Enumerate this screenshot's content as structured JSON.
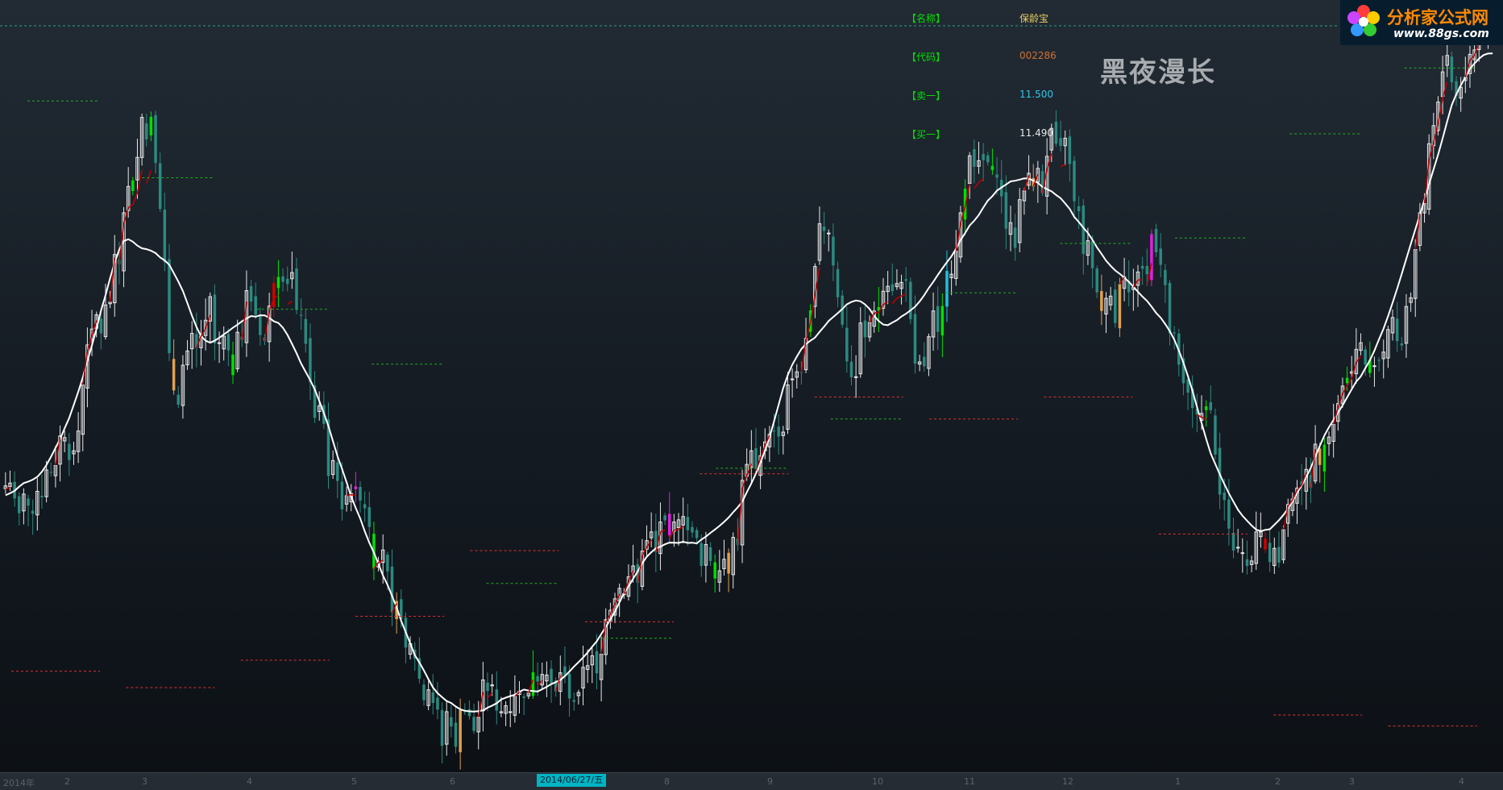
{
  "info_panel": {
    "name_label": "【名称】",
    "name_value": "保龄宝",
    "code_label": "【代码】",
    "code_value": "002286",
    "sell1_label": "【卖一】",
    "sell1_value": "11.500",
    "buy1_label": "【买一】",
    "buy1_value": "11.490"
  },
  "logo": {
    "title": "分析家公式网",
    "url": "www.88gs.com"
  },
  "watermark": "黑夜漫长",
  "time_axis": {
    "labels": [
      "2014年",
      "2",
      "3",
      "4",
      "5",
      "6",
      "8",
      "9",
      "10",
      "11",
      "12",
      "1",
      "2",
      "3",
      "4"
    ],
    "cursor_date": "2014/06/27/五"
  },
  "colors": {
    "up": "#e8e8e8",
    "down": "#2c8a80",
    "signal_green": "#00e000",
    "signal_red": "#d00000",
    "signal_magenta": "#e020e0",
    "signal_orange": "#e0a050",
    "signal_cyan": "#20c0e0",
    "ma_line": "#ffffff",
    "support": "#e03030",
    "resistance": "#20b020"
  },
  "chart_data": {
    "type": "candlestick",
    "title": "",
    "xlabel": "",
    "ylabel": "",
    "series": [
      {
        "name": "close",
        "values": [
          9.78,
          9.83,
          9.55,
          9.28,
          9.63,
          9.42,
          9.27,
          9.68,
          9.57,
          10.07,
          10.03,
          10.15,
          10.69,
          10.66,
          10.25,
          10.42,
          10.78,
          11.62,
          12.35,
          12.64,
          12.9,
          12.56,
          13.08,
          13.13,
          14.0,
          13.82,
          14.76,
          15.24,
          15.35,
          15.77,
          16.5,
          16.1,
          16.51,
          15.67,
          14.83,
          13.86,
          12.2,
          11.52,
          11.26,
          11.98,
          12.24,
          12.56,
          12.3,
          12.51,
          12.8,
          13.23,
          12.38,
          12.39,
          12.51,
          12.25,
          11.8,
          12.58,
          12.44,
          13.34,
          13.14,
          12.9,
          12.53,
          12.42,
          13.06,
          13.48,
          13.59,
          13.5,
          13.46,
          13.67,
          12.99,
          12.88,
          12.37,
          11.67,
          11.02,
          11.24,
          10.91,
          9.96,
          10.24,
          9.87,
          9.35,
          9.6,
          9.64,
          9.77,
          9.51,
          9.37,
          9.03,
          8.27,
          8.4,
          8.61,
          8.22,
          7.47,
          7.68,
          7.35,
          6.83,
          6.9,
          6.63,
          6.26,
          5.87,
          6.06,
          5.82,
          5.7,
          5.04,
          5.66,
          5.39,
          5.02,
          5.69,
          5.65,
          5.58,
          5.31,
          5.56,
          6.24,
          6.04,
          6.15,
          5.68,
          5.66,
          5.77,
          5.66,
          5.94,
          6.03,
          5.91,
          6.0,
          6.38,
          6.21,
          6.34,
          6.33,
          6.18,
          6.03,
          6.37,
          6.31,
          5.9,
          5.84,
          6.01,
          6.47,
          6.5,
          6.68,
          6.36,
          6.71,
          7.34,
          7.51,
          7.72,
          7.91,
          7.81,
          8.12,
          8.32,
          8.01,
          8.59,
          8.78,
          8.94,
          8.57,
          9.12,
          9.15,
          8.88,
          9.12,
          9.16,
          9.22,
          8.97,
          8.93,
          8.83,
          8.32,
          8.71,
          8.41,
          8.09,
          8.23,
          8.44,
          8.18,
          8.84,
          8.7,
          9.88,
          10.17,
          10.42,
          10.09,
          10.33,
          10.58,
          10.72,
          10.77,
          10.68,
          10.76,
          11.62,
          11.73,
          11.86,
          11.84,
          12.47,
          12.98,
          13.78,
          14.56,
          14.43,
          14.39,
          13.8,
          13.22,
          12.72,
          12.05,
          11.76,
          11.77,
          12.75,
          12.49,
          12.76,
          12.97,
          13.04,
          13.33,
          13.42,
          13.33,
          13.47,
          13.49,
          13.52,
          12.82,
          12.01,
          12.04,
          11.96,
          12.5,
          12.97,
          12.59,
          13.06,
          13.7,
          13.64,
          14.06,
          14.76,
          15.2,
          15.8,
          15.6,
          15.71,
          15.72,
          15.68,
          15.54,
          15.4,
          15.06,
          14.47,
          14.58,
          14.12,
          15.0,
          15.16,
          15.48,
          15.24,
          15.57,
          15.12,
          15.79,
          16.3,
          16.02,
          15.98,
          16.12,
          15.65,
          14.97,
          14.79,
          14.01,
          14.25,
          13.75,
          13.31,
          12.97,
          13.2,
          13.24,
          12.75,
          13.46,
          13.59,
          13.31,
          13.4,
          13.68,
          13.74,
          13.64,
          14.37,
          14.04,
          13.81,
          13.44,
          12.56,
          12.56,
          11.99,
          11.65,
          11.48,
          11.2,
          11.08,
          11.1,
          11.23,
          11.16,
          10.35,
          9.62,
          9.52,
          9.0,
          8.6,
          8.66,
          8.56,
          8.32,
          8.41,
          8.94,
          8.94,
          8.62,
          8.39,
          8.64,
          8.38,
          8.98,
          9.44,
          9.54,
          9.74,
          9.8,
          10.08,
          9.75,
          10.54,
          10.16,
          10.53,
          10.67,
          10.9,
          11.28,
          11.6,
          11.75,
          11.86,
          12.27,
          12.39,
          11.99,
          11.84,
          11.97,
          12.06,
          12.22,
          12.63,
          12.85,
          12.42,
          12.34,
          13.05,
          13.21,
          14.09,
          14.76,
          14.93,
          16.02,
          16.35,
          16.78,
          17.33,
          17.63,
          17.14,
          16.89,
          17.05,
          17.23,
          17.65,
          17.73,
          18.04,
          18.03,
          18.15,
          18.77
        ]
      }
    ],
    "support_levels": [
      6.4,
      6.1,
      6.6,
      7.4,
      8.6,
      7.3,
      10.0,
      11.4,
      11.0,
      11.4,
      8.9,
      5.6,
      5.4
    ],
    "resistance_levels": [
      16.8,
      15.4,
      13.0,
      12.0,
      8.0,
      7.0,
      10.1,
      11.0,
      13.3,
      14.2,
      14.3,
      16.2,
      17.4
    ],
    "y_range": [
      4.6,
      18.2
    ]
  }
}
